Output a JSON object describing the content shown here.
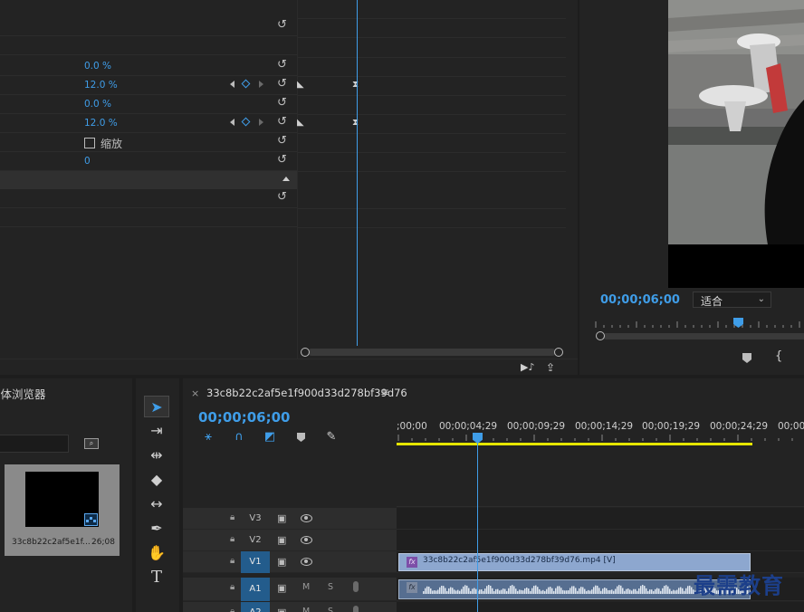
{
  "effect_controls": {
    "rows": [
      {
        "value": "",
        "keyframes": false
      },
      {
        "value": "",
        "keyframes": false
      },
      {
        "value": "0.0 %",
        "keyframes": false
      },
      {
        "value": "12.0 %",
        "keyframes": true
      },
      {
        "value": "0.0 %",
        "keyframes": false
      },
      {
        "value": "12.0 %",
        "keyframes": true
      },
      {
        "value": "缩放",
        "keyframes": false,
        "checkbox": true
      },
      {
        "value": "0",
        "keyframes": false
      }
    ]
  },
  "program_monitor": {
    "timecode": "00;00;06;00",
    "fit_label": "适合",
    "playhead_fraction": 0.69
  },
  "media_browser": {
    "title": "媒体浏览器",
    "search_icon": "search-icon",
    "item": {
      "name": "33c8b22c2af5e1f...",
      "duration": "26;08"
    }
  },
  "tools": [
    "selection-tool",
    "track-select-tool",
    "ripple-edit-tool",
    "razor-tool",
    "slip-tool",
    "pen-tool",
    "hand-tool",
    "type-tool"
  ],
  "timeline": {
    "sequence_name": "33c8b22c2af5e1f900d33d278bf39d76",
    "timecode": "00;00;06;00",
    "ruler_labels": [
      ";00;00",
      "00;00;04;29",
      "00;00;09;29",
      "00;00;14;29",
      "00;00;19;29",
      "00;00;24;29",
      "00;00"
    ],
    "tracks": [
      {
        "name": "V3",
        "kind": "video",
        "active": false
      },
      {
        "name": "V2",
        "kind": "video",
        "active": false
      },
      {
        "name": "V1",
        "kind": "video",
        "active": true
      },
      {
        "name": "A1",
        "kind": "audio",
        "active": true
      },
      {
        "name": "A2",
        "kind": "audio",
        "active": true
      }
    ],
    "audio_labels": {
      "mute": "M",
      "solo": "S"
    },
    "video_clip_label": "33c8b22c2af5e1f900d33d278bf39d76.mp4 [V]",
    "fx_label": "fx"
  },
  "watermark": "最需教育",
  "colors": {
    "accent": "#3f9de8",
    "work_area": "#e6e600",
    "video_clip": "#8da7cf",
    "audio_clip": "#566e90"
  }
}
